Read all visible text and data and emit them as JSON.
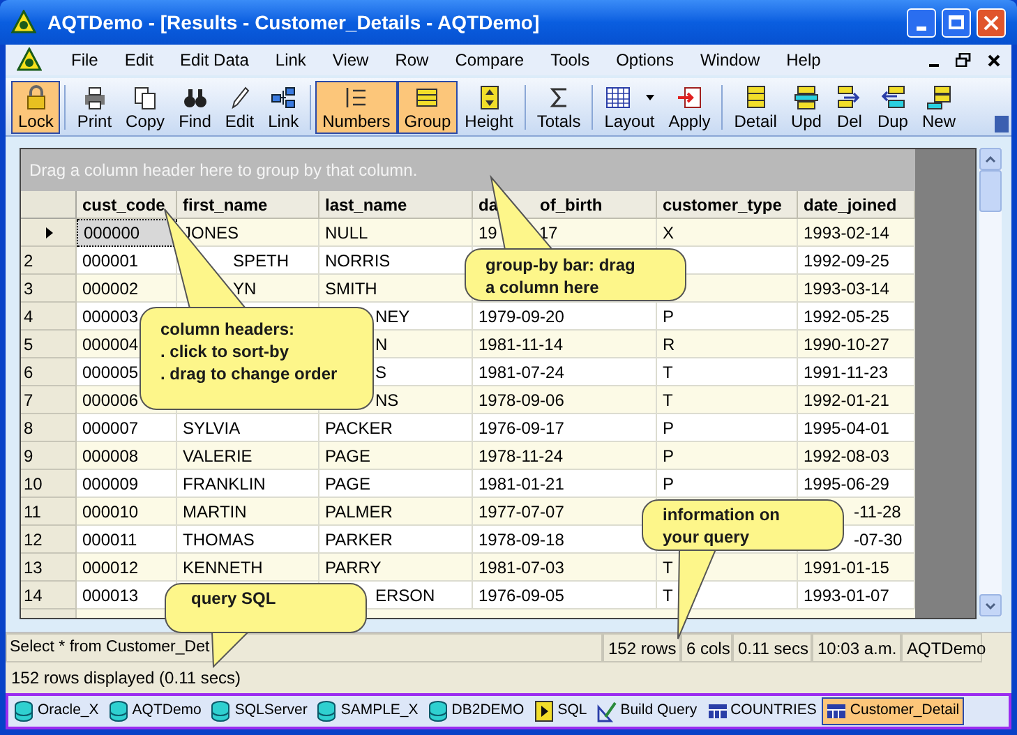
{
  "window": {
    "title": "AQTDemo - [Results - Customer_Details - AQTDemo]"
  },
  "menu": [
    "File",
    "Edit",
    "Edit Data",
    "Link",
    "View",
    "Row",
    "Compare",
    "Tools",
    "Options",
    "Window",
    "Help"
  ],
  "toolbar": [
    {
      "label": "Lock",
      "active": true
    },
    {
      "label": "Print",
      "active": false
    },
    {
      "label": "Copy",
      "active": false
    },
    {
      "label": "Find",
      "active": false
    },
    {
      "label": "Edit",
      "active": false
    },
    {
      "label": "Link",
      "active": false
    },
    {
      "label": "Numbers",
      "active": true
    },
    {
      "label": "Group",
      "active": true
    },
    {
      "label": "Height",
      "active": false
    },
    {
      "label": "Totals",
      "active": false
    },
    {
      "label": "Layout",
      "active": false
    },
    {
      "label": "Apply",
      "active": false
    },
    {
      "label": "Detail",
      "active": false
    },
    {
      "label": "Upd",
      "active": false
    },
    {
      "label": "Del",
      "active": false
    },
    {
      "label": "Dup",
      "active": false
    },
    {
      "label": "New",
      "active": false
    }
  ],
  "group_bar": {
    "placeholder": "Drag a column header here to group by that column."
  },
  "table": {
    "columns": [
      "cust_code",
      "first_name",
      "last_name",
      [
        "da",
        "of_birth"
      ],
      "customer_type",
      "date_joined"
    ],
    "rows": [
      {
        "label": "",
        "selected": true,
        "cells": [
          "000000",
          "JONES",
          "NULL",
          [
            "19",
            "17"
          ],
          "X",
          "1993-02-14"
        ]
      },
      {
        "label": "2",
        "selected": false,
        "cells": [
          "000001",
          {
            "text": "SPETH",
            "cut": true
          },
          "NORRIS",
          null,
          null,
          "1992-09-25"
        ]
      },
      {
        "label": "3",
        "selected": false,
        "cells": [
          "000002",
          {
            "text": "YN",
            "cut": true
          },
          "SMITH",
          null,
          null,
          "1993-03-14"
        ]
      },
      {
        "label": "4",
        "selected": false,
        "cells": [
          "000003",
          null,
          {
            "text": "NEY",
            "cut": true
          },
          "1979-09-20",
          "P",
          "1992-05-25"
        ]
      },
      {
        "label": "5",
        "selected": false,
        "cells": [
          "000004",
          null,
          {
            "text": "N",
            "cut": true
          },
          "1981-11-14",
          "R",
          "1990-10-27"
        ]
      },
      {
        "label": "6",
        "selected": false,
        "cells": [
          "000005",
          null,
          {
            "text": "S",
            "cut": true
          },
          "1981-07-24",
          "T",
          "1991-11-23"
        ]
      },
      {
        "label": "7",
        "selected": false,
        "cells": [
          "000006",
          null,
          {
            "text": "NS",
            "cut": true
          },
          "1978-09-06",
          "T",
          "1992-01-21"
        ]
      },
      {
        "label": "8",
        "selected": false,
        "cells": [
          "000007",
          "SYLVIA",
          "PACKER",
          "1976-09-17",
          "P",
          "1995-04-01"
        ]
      },
      {
        "label": "9",
        "selected": false,
        "cells": [
          "000008",
          "VALERIE",
          "PAGE",
          "1978-11-24",
          "P",
          "1992-08-03"
        ]
      },
      {
        "label": "10",
        "selected": false,
        "cells": [
          "000009",
          "FRANKLIN",
          "PAGE",
          "1981-01-21",
          "P",
          "1995-06-29"
        ]
      },
      {
        "label": "11",
        "selected": false,
        "cells": [
          "000010",
          "MARTIN",
          "PALMER",
          "1977-07-07",
          null,
          {
            "text": "-11-28",
            "cut": true
          }
        ]
      },
      {
        "label": "12",
        "selected": false,
        "cells": [
          "000011",
          "THOMAS",
          "PARKER",
          "1978-09-18",
          null,
          {
            "text": "-07-30",
            "cut": true
          }
        ]
      },
      {
        "label": "13",
        "selected": false,
        "cells": [
          "000012",
          "KENNETH",
          "PARRY",
          "1981-07-03",
          "T",
          "1991-01-15"
        ]
      },
      {
        "label": "14",
        "selected": false,
        "cells": [
          "000013",
          null,
          {
            "text": "ERSON",
            "cut": true
          },
          "1976-09-05",
          "T",
          "1993-01-07"
        ]
      }
    ]
  },
  "callouts": [
    {
      "lines": [
        "column headers:",
        ". click to sort-by",
        ". drag to change order"
      ]
    },
    {
      "lines": [
        "group-by bar: drag",
        "a column here"
      ]
    },
    {
      "lines": [
        "information on",
        "your query"
      ]
    },
    {
      "lines": [
        "query SQL"
      ]
    }
  ],
  "status_bar": {
    "sql": "Select * from Customer_Det",
    "fields": [
      "152 rows",
      "6 cols",
      "0.11 secs",
      "10:03 a.m.",
      "AQTDemo"
    ],
    "message": "152 rows displayed (0.11 secs)"
  },
  "taskbar": [
    {
      "label": "Oracle_X",
      "kind": "database",
      "selected": false
    },
    {
      "label": "AQTDemo",
      "kind": "database",
      "selected": false
    },
    {
      "label": "SQLServer",
      "kind": "database",
      "selected": false
    },
    {
      "label": "SAMPLE_X",
      "kind": "database",
      "selected": false
    },
    {
      "label": "DB2DEMO",
      "kind": "database",
      "selected": false
    },
    {
      "label": "SQL",
      "kind": "sql",
      "selected": false
    },
    {
      "label": "Build Query",
      "kind": "query",
      "selected": false
    },
    {
      "label": "COUNTRIES",
      "kind": "table",
      "selected": false
    },
    {
      "label": "Customer_Detail",
      "kind": "table",
      "selected": true
    }
  ]
}
